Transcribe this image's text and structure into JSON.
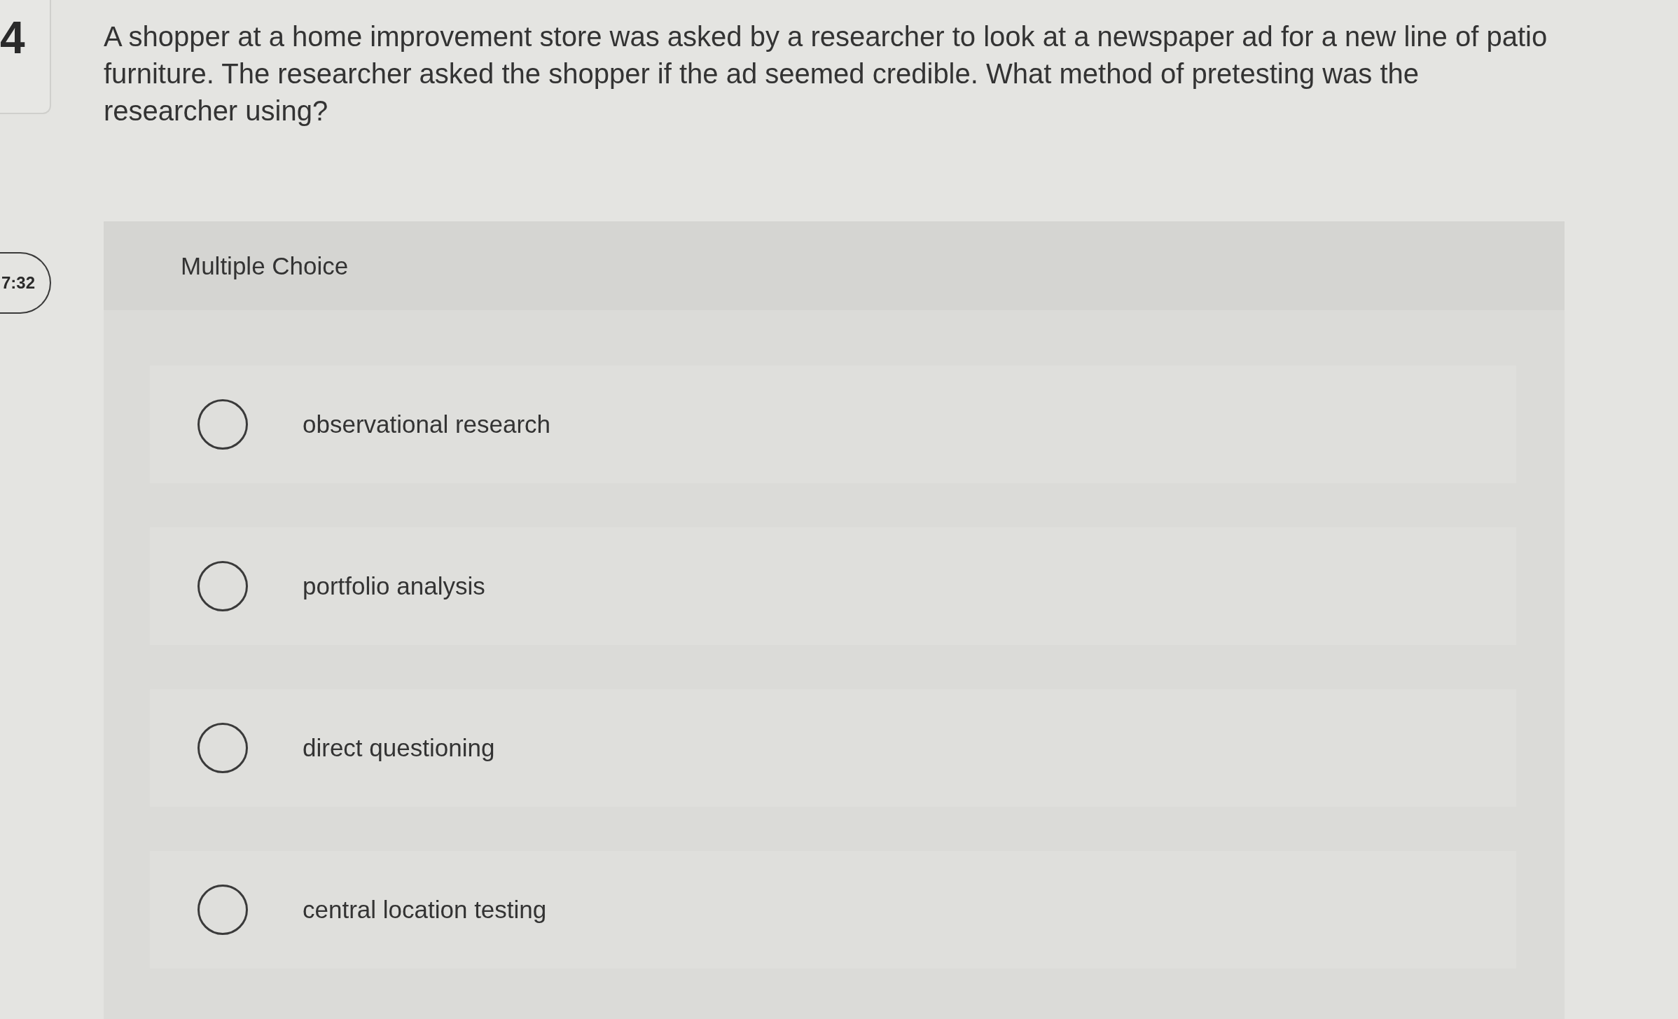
{
  "question_number": "4",
  "timer": "7:32",
  "question": "A shopper at a home improvement store was asked by a researcher to look at a newspaper ad for a new line of patio furniture. The researcher asked the shopper if the ad seemed credible. What method of pretesting was the researcher using?",
  "answer_type": "Multiple Choice",
  "options": [
    {
      "label": "observational research",
      "selected": false
    },
    {
      "label": "portfolio analysis",
      "selected": false
    },
    {
      "label": "direct questioning",
      "selected": false
    },
    {
      "label": "central location testing",
      "selected": false
    }
  ]
}
